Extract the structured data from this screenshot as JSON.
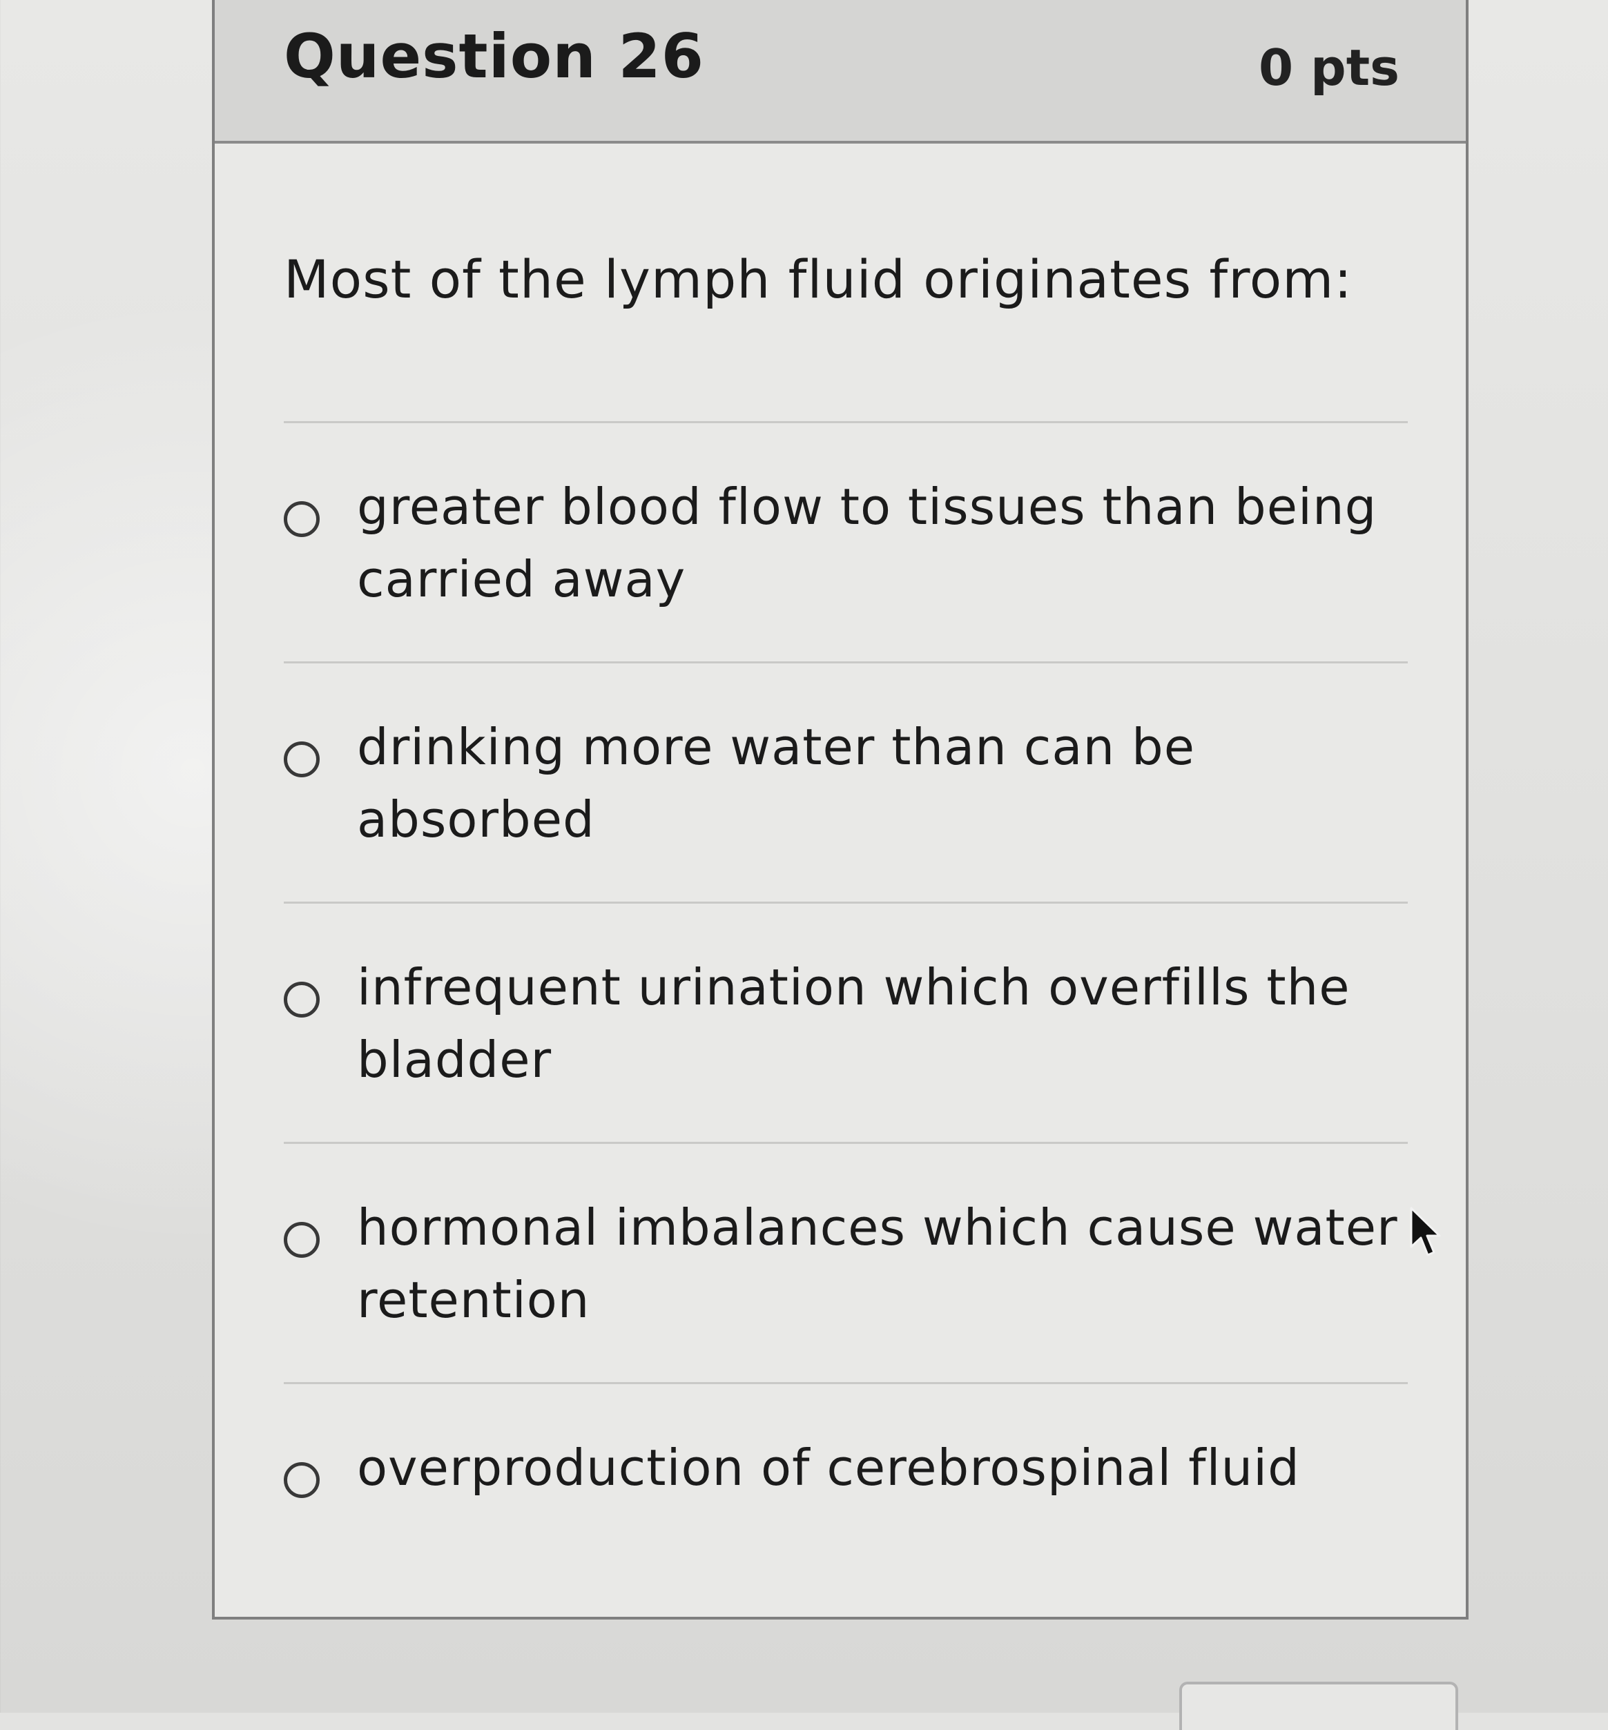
{
  "question": {
    "title": "Question 26",
    "points": "0 pts",
    "prompt": "Most of the lymph fluid originates from:",
    "answers": [
      {
        "text": "greater blood flow to tissues than being carried away",
        "selected": false
      },
      {
        "text": "drinking more water than can be absorbed",
        "selected": false
      },
      {
        "text": "infrequent urination which overfills the bladder",
        "selected": false
      },
      {
        "text": "hormonal imbalances which cause water retention",
        "selected": false
      },
      {
        "text": "overproduction of cerebrospinal fluid",
        "selected": false
      }
    ]
  },
  "icons": {
    "radio": "radio-button-icon",
    "cursor": "mouse-pointer-icon"
  },
  "colors": {
    "header_background": "#d5d5d3",
    "card_background": "#e9e9e7",
    "text": "#1b1b1b",
    "border": "#7f7f7f"
  }
}
